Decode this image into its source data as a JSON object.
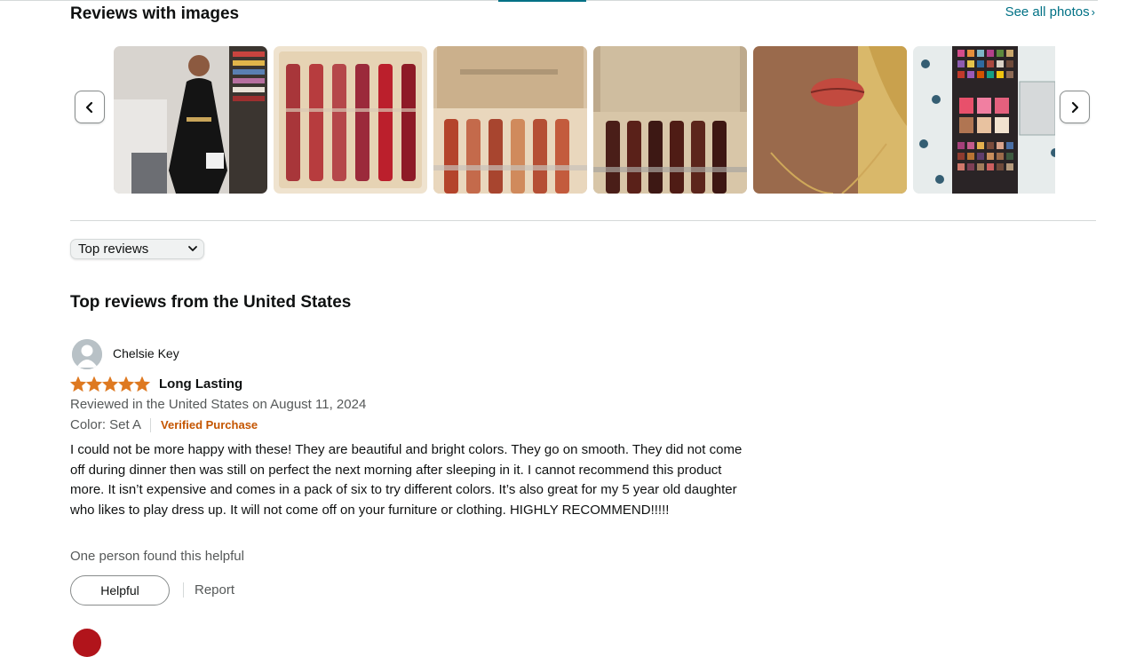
{
  "images_section": {
    "title": "Reviews with images",
    "see_all_label": "See all photos",
    "see_all_chevron": "›",
    "prev_icon": "chevron-left-icon",
    "next_icon": "chevron-right-icon",
    "thumbnails": [
      {
        "subject": "woman in black outfit"
      },
      {
        "subject": "six red lip glosses in box"
      },
      {
        "subject": "nude lip gloss set in box"
      },
      {
        "subject": "dark lip gloss set in box"
      },
      {
        "subject": "lips wearing red lipstick"
      },
      {
        "subject": "eyeshadow palette"
      }
    ]
  },
  "sort": {
    "selected": "Top reviews",
    "icon": "chevron-down-icon"
  },
  "reviews_section": {
    "title": "Top reviews from the United States"
  },
  "review": {
    "author": "Chelsie Key",
    "rating": 5,
    "rating_max": 5,
    "star_color": "#de7921",
    "headline": "Long Lasting",
    "date_line": "Reviewed in the United States on August 11, 2024",
    "color_label": "Color: Set A",
    "verified_label": "Verified Purchase",
    "body": "I could not be more happy with these! They are beautiful and bright colors. They go on smooth. They did not come off during dinner then was still on perfect the next morning after sleeping in it. I cannot recommend this product more. It isn’t expensive and comes in a pack of six to try different colors. It’s also great for my 5 year old daughter who likes to play dress up. It will not come off on your furniture or clothing. HIGHLY RECOMMEND!!!!!",
    "helpful_count": "One person found this helpful",
    "helpful_button": "Helpful",
    "report_label": "Report"
  },
  "colors": {
    "link": "#007185",
    "verified": "#c45500",
    "muted_text": "#565959"
  }
}
